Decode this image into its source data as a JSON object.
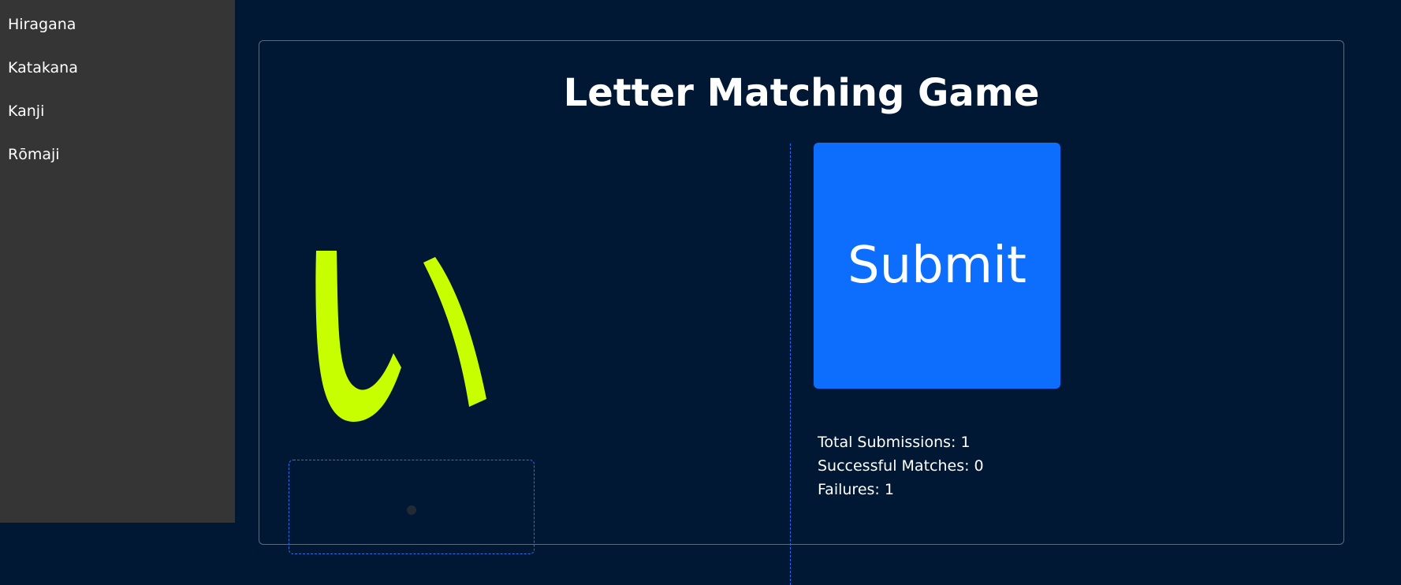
{
  "sidebar": {
    "items": [
      {
        "label": "Hiragana"
      },
      {
        "label": "Katakana"
      },
      {
        "label": "Kanji"
      },
      {
        "label": "Rōmaji"
      }
    ]
  },
  "game": {
    "title": "Letter Matching Game",
    "glyph": "い",
    "glyph_color": "#c8ff00",
    "submit_label": "Submit",
    "accent_color": "#0d6efd"
  },
  "stats": {
    "total": "Total Submissions: 1",
    "successes": "Successful Matches: 0",
    "failures": "Failures: 1"
  }
}
